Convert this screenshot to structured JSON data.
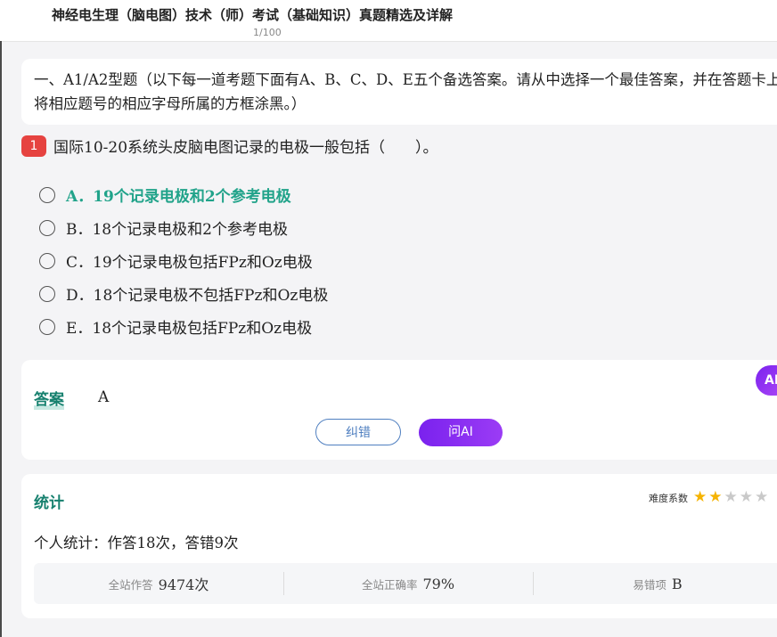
{
  "header": {
    "title": "神经电生理（脑电图）技术（师）考试（基础知识）真题精选及详解",
    "page_indicator": "1/100"
  },
  "section": {
    "text": "一、A1/A2型题（以下每一道考题下面有A、B、C、D、E五个备选答案。请从中选择一个最佳答案，并在答题卡上将相应题号的相应字母所属的方框涂黑。）"
  },
  "question": {
    "number": "1",
    "text": "国际10-20系统头皮脑电图记录的电极一般包括（　　）。",
    "options": [
      {
        "label": "A．19个记录电极和2个参考电极",
        "correct": true
      },
      {
        "label": "B．18个记录电极和2个参考电极",
        "correct": false
      },
      {
        "label": "C．19个记录电极包括FPz和Oz电极",
        "correct": false
      },
      {
        "label": "D．18个记录电极不包括FPz和Oz电极",
        "correct": false
      },
      {
        "label": "E．18个记录电极包括FPz和Oz电极",
        "correct": false
      }
    ]
  },
  "answer": {
    "label": "答案",
    "value": "A",
    "report_button": "纠错",
    "ask_ai_button": "问AI",
    "ai_float": "AI"
  },
  "stats": {
    "title": "统计",
    "difficulty_label": "难度系数",
    "difficulty_stars": 2,
    "difficulty_max": 5,
    "personal": "个人统计：作答18次，答错9次",
    "site_answers_label": "全站作答",
    "site_answers_value": "9474次",
    "site_accuracy_label": "全站正确率",
    "site_accuracy_value": "79%",
    "common_wrong_label": "易错项",
    "common_wrong_value": "B"
  },
  "colors": {
    "accent": "#21a38a",
    "badge": "#e64340",
    "ai_purple": "#7a22ee",
    "star": "#f5b301"
  }
}
